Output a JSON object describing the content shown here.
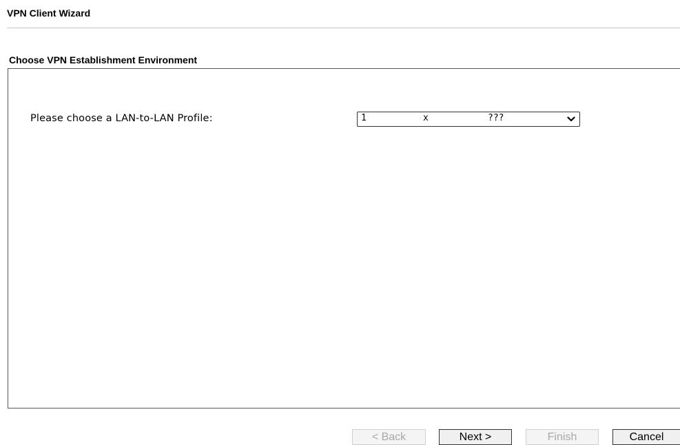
{
  "header": {
    "title": "VPN Client Wizard"
  },
  "section": {
    "title": "Choose VPN Establishment Environment"
  },
  "form": {
    "profile_label": "Please choose a LAN-to-LAN Profile:",
    "profile_select": {
      "selected_index": "1",
      "selected_status": "x",
      "selected_name": "???"
    }
  },
  "buttons": {
    "back": "< Back",
    "next": "Next >",
    "finish": "Finish",
    "cancel": "Cancel"
  },
  "icons": {
    "dropdown": "chevron-down-icon"
  }
}
